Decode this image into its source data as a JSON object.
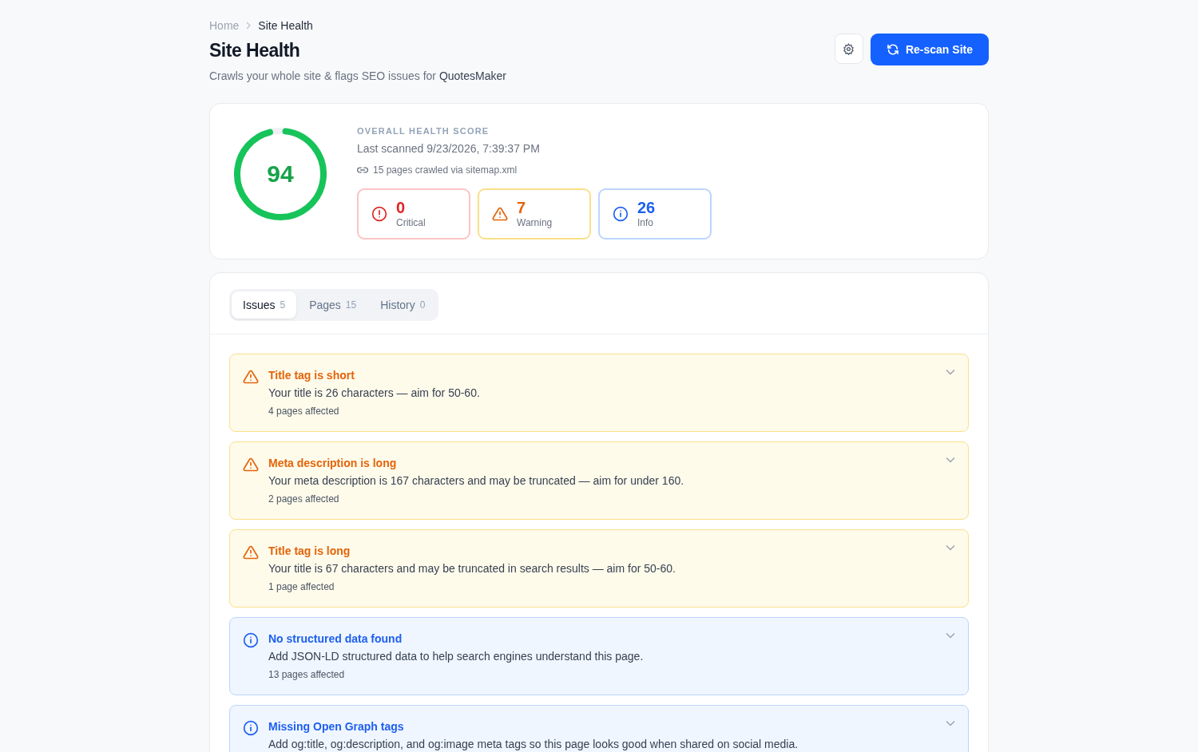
{
  "breadcrumb": [
    {
      "label": "Home",
      "current": false
    },
    {
      "label": "Site Health",
      "current": true
    }
  ],
  "header": {
    "title": "Site Health",
    "subtitle": "Crawls your whole site & flags SEO issues for **QuotesMaker**",
    "rescan_button": "Re-scan Site"
  },
  "score_card": {
    "score": "94",
    "level": 0.94,
    "heading": "OVERALL HEALTH SCORE",
    "last_scanned": "Last scanned 9/23/2026, 7:39:37 PM",
    "crawl_info": "15 pages crawled via sitemap.xml",
    "counts": [
      {
        "kind": "critical",
        "count": "0",
        "label": "Critical"
      },
      {
        "kind": "warning",
        "count": "7",
        "label": "Warning"
      },
      {
        "kind": "info",
        "count": "26",
        "label": "Info"
      }
    ]
  },
  "tabs": [
    {
      "label": "Issues",
      "count": "5",
      "selected": true
    },
    {
      "label": "Pages",
      "count": "15",
      "selected": false
    },
    {
      "label": "History",
      "count": "0",
      "selected": false
    }
  ],
  "issues": [
    {
      "kind": "warning",
      "title": "Title tag is short",
      "description": "Your title is 26 characters — aim for 50-60.",
      "affected": "4 pages affected"
    },
    {
      "kind": "warning",
      "title": "Meta description is long",
      "description": "Your meta description is 167 characters and may be truncated — aim for under 160.",
      "affected": "2 pages affected"
    },
    {
      "kind": "warning",
      "title": "Title tag is long",
      "description": "Your title is 67 characters and may be truncated in search results — aim for 50-60.",
      "affected": "1 page affected"
    },
    {
      "kind": "info",
      "title": "No structured data found",
      "description": "Add JSON-LD structured data to help search engines understand this page.",
      "affected": "13 pages affected"
    },
    {
      "kind": "info",
      "title": "Missing Open Graph tags",
      "description": "Add og:title, og:description, and og:image meta tags so this page looks good when shared on social media."
    }
  ]
}
